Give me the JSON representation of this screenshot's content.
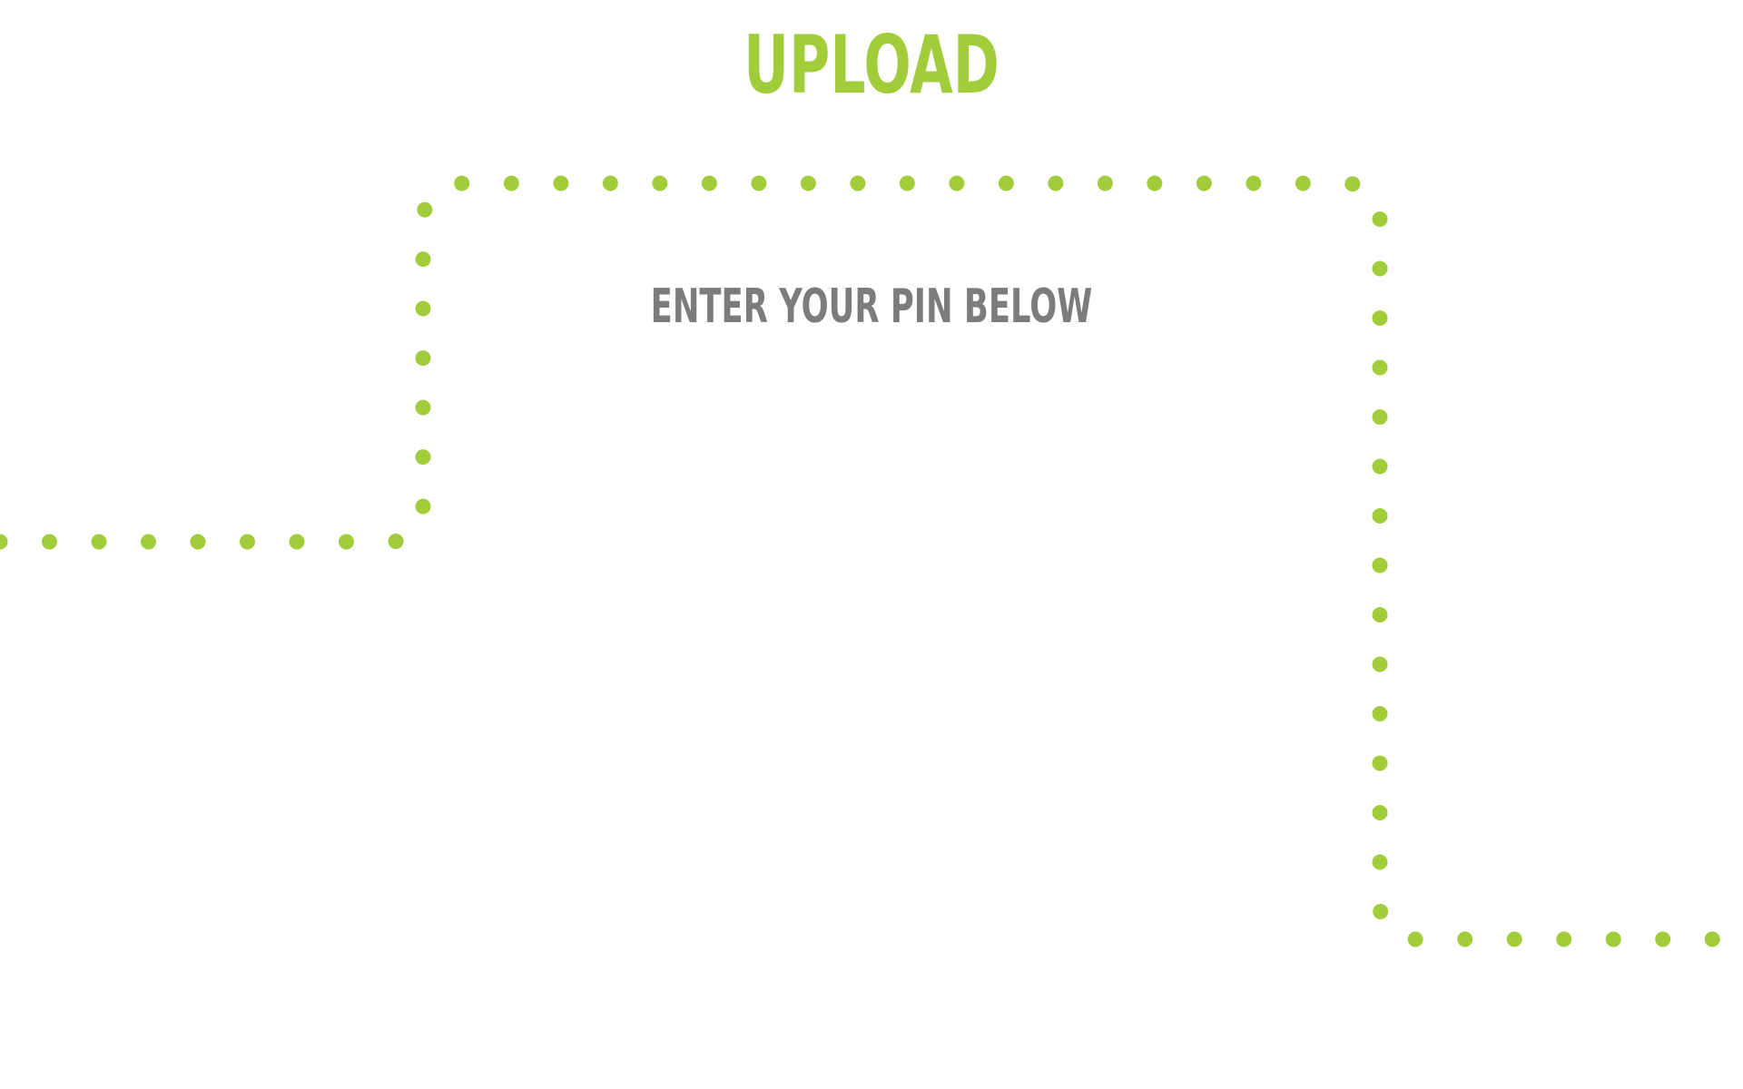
{
  "page": {
    "title": "UPLOAD",
    "prompt": "ENTER YOUR PIN BELOW"
  },
  "colors": {
    "accent": "#a2cd3a",
    "prompt_text": "#7c7c7c",
    "background": "#ffffff"
  },
  "decoration": {
    "dotted_path": "dotted-line"
  }
}
